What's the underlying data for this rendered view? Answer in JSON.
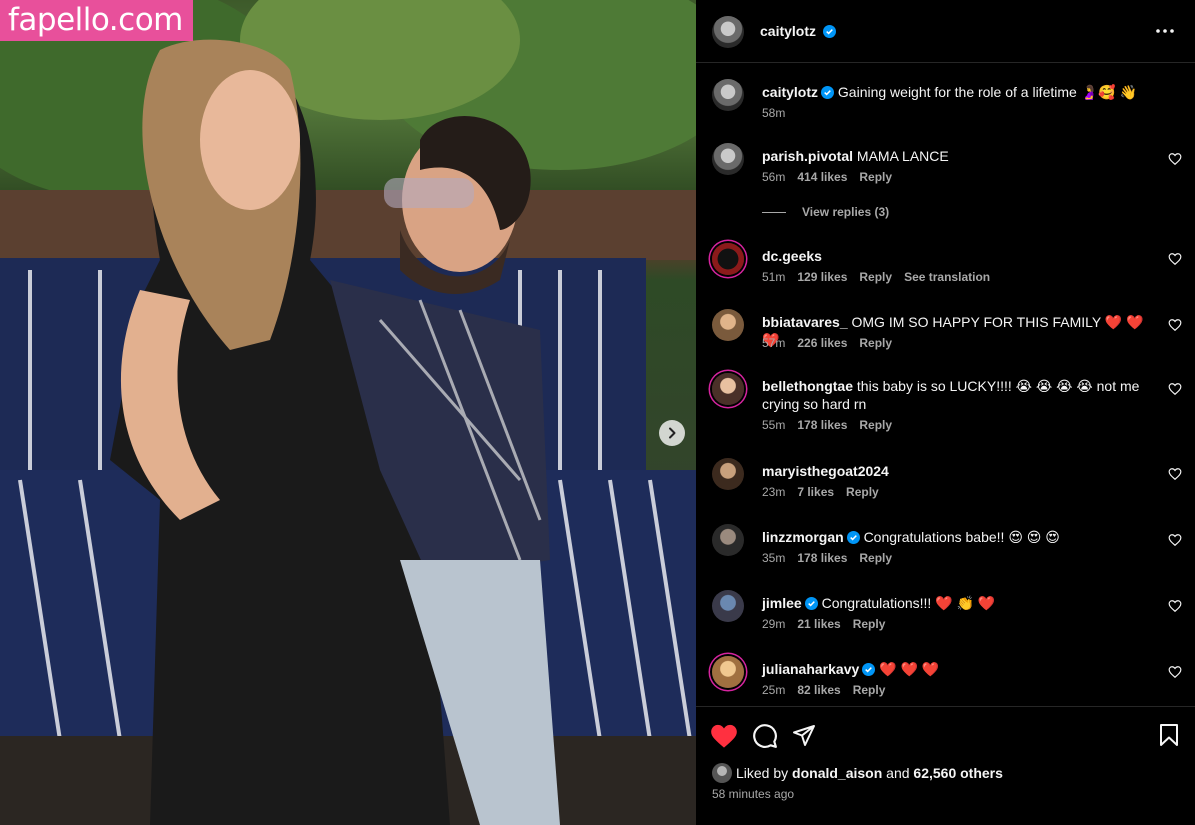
{
  "watermark": "fapello.com",
  "post": {
    "author": "caitylotz",
    "caption": "Gaining weight for the role of a lifetime 🤰🥰 👋",
    "caption_time": "58m"
  },
  "comments": [
    {
      "user": "parish.pivotal",
      "verified": false,
      "text": "MAMA LANCE",
      "time": "56m",
      "likes": "414 likes",
      "reply": "Reply",
      "view_replies": "View replies (3)"
    },
    {
      "user": "dc.geeks",
      "verified": false,
      "text": "",
      "time": "51m",
      "likes": "129 likes",
      "reply": "Reply",
      "translate": "See translation"
    },
    {
      "user": "bbiatavares_",
      "verified": false,
      "text": "OMG IM SO HAPPY FOR THIS FAMILY ❤️ ❤️ ❤️",
      "time": "57m",
      "likes": "226 likes",
      "reply": "Reply"
    },
    {
      "user": "bellethongtae",
      "verified": false,
      "text": "this baby is so LUCKY!!!! 😭 😭 😭 😭 not me crying so hard rn",
      "time": "55m",
      "likes": "178 likes",
      "reply": "Reply"
    },
    {
      "user": "maryisthegoat2024",
      "verified": false,
      "text": "",
      "time": "23m",
      "likes": "7 likes",
      "reply": "Reply"
    },
    {
      "user": "linzzmorgan",
      "verified": true,
      "text": "Congratulations babe!! 😍 😍 😍",
      "time": "35m",
      "likes": "178 likes",
      "reply": "Reply"
    },
    {
      "user": "jimlee",
      "verified": true,
      "text": "Congratulations!!! ❤️ 👏 ❤️",
      "time": "29m",
      "likes": "21 likes",
      "reply": "Reply"
    },
    {
      "user": "julianaharkavy",
      "verified": true,
      "text": "❤️ ❤️ ❤️",
      "time": "25m",
      "likes": "82 likes",
      "reply": "Reply"
    }
  ],
  "likes": {
    "prefix": "Liked by",
    "user": "donald_aison",
    "middle": "and",
    "count": "62,560 others"
  },
  "posted_time": "58 minutes ago",
  "colors": {
    "like_red": "#ff3040",
    "verified_blue": "#0095f6",
    "watermark_pink": "#e8509b"
  }
}
